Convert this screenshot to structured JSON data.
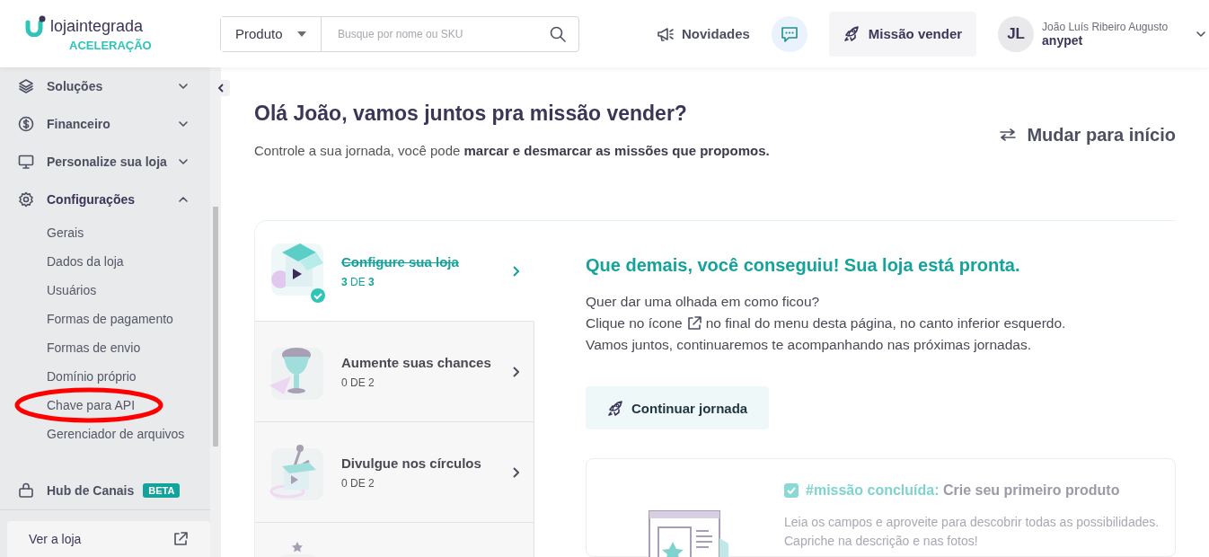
{
  "header": {
    "logo_text": "lojaintegrada",
    "logo_tag": "ACELERAÇÃO",
    "search": {
      "category": "Produto",
      "placeholder": "Busque por nome ou SKU"
    },
    "news_label": "Novidades",
    "mission_button": "Missão vender",
    "user": {
      "initials": "JL",
      "name": "João Luís Ribeiro Augusto",
      "store": "anypet"
    }
  },
  "sidebar": {
    "items": [
      {
        "kind": "group",
        "label": "Soluções",
        "expanded": false
      },
      {
        "kind": "group",
        "label": "Financeiro",
        "expanded": false
      },
      {
        "kind": "group",
        "label": "Personalize sua loja",
        "expanded": false
      },
      {
        "kind": "group",
        "label": "Configurações",
        "expanded": true,
        "children": [
          {
            "label": "Gerais",
            "circled": false
          },
          {
            "label": "Dados da loja",
            "circled": false
          },
          {
            "label": "Usuários",
            "circled": false
          },
          {
            "label": "Formas de pagamento",
            "circled": false
          },
          {
            "label": "Formas de envio",
            "circled": false
          },
          {
            "label": "Domínio próprio",
            "circled": false
          },
          {
            "label": "Chave para API",
            "circled": true
          },
          {
            "label": "Gerenciador de arquivos",
            "circled": false
          }
        ]
      },
      {
        "kind": "link",
        "label": "Hub de Canais",
        "badge": "BETA"
      }
    ],
    "footer_link": "Ver a loja"
  },
  "main": {
    "title": "Olá João, vamos juntos pra missão vender?",
    "subtitle": "Controle a sua jornada, você pode **marcar e desmarcar as missões que propomos.**",
    "switch_link": "Mudar para início",
    "missions": [
      {
        "title": "Configure sua loja",
        "progress": "**3** DE **3**",
        "completed": true,
        "selected": true
      },
      {
        "title": "Aumente suas chances",
        "progress": "0 DE 2",
        "completed": false,
        "selected": false
      },
      {
        "title": "Divulgue nos círculos",
        "progress": "0 DE 2",
        "completed": false,
        "selected": false
      },
      {
        "selected": false
      }
    ],
    "detail": {
      "heading": "Que demais, você conseguiu! Sua loja está pronta.",
      "line_1": "Quer dar uma olhada em como ficou?",
      "line_2_before": "Clique no ícone",
      "line_2_after": "no final do menu desta página, no canto inferior esquerdo.",
      "line_3": "Vamos juntos, continuaremos te acompanhando nas próximas jornadas.",
      "button": "Continuar jornada",
      "task": {
        "checked": true,
        "tag": "#missão concluída:",
        "title": "Crie seu primeiro produto",
        "description": [
          "Leia os campos e aproveite para descobrir todas as possibilidades.",
          "Capriche na descrição e nas fotos!"
        ]
      }
    }
  }
}
